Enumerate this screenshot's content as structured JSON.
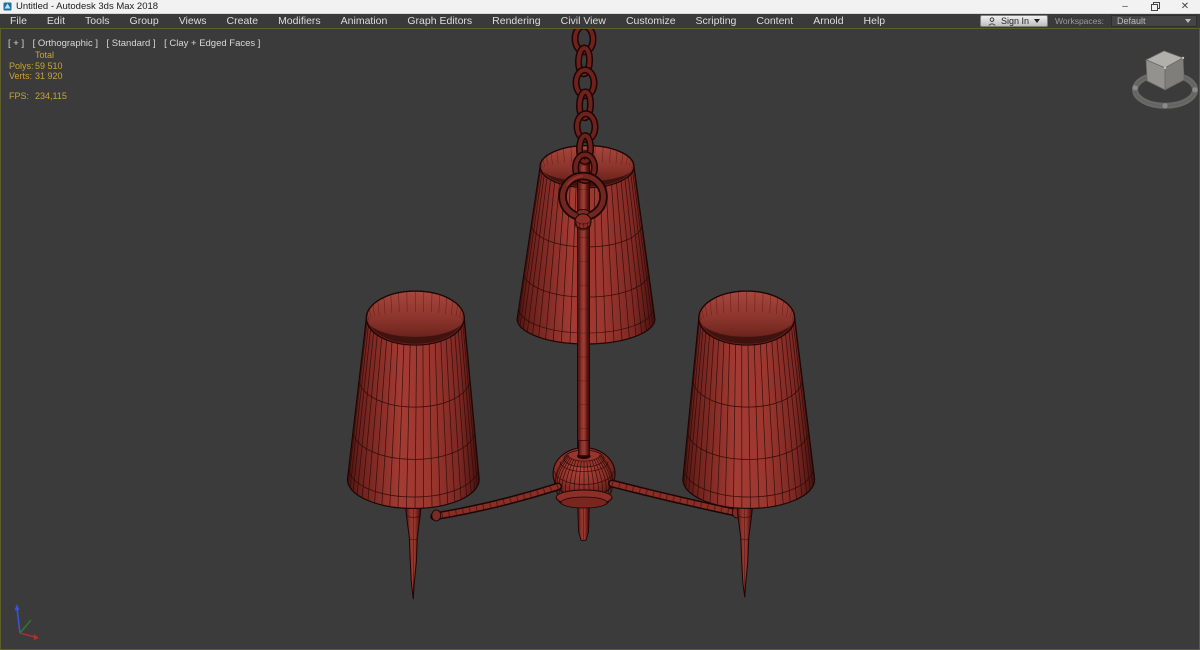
{
  "window": {
    "title": "Untitled - Autodesk 3ds Max 2018",
    "minimize": "–",
    "close": "✕"
  },
  "menu": {
    "items": [
      "File",
      "Edit",
      "Tools",
      "Group",
      "Views",
      "Create",
      "Modifiers",
      "Animation",
      "Graph Editors",
      "Rendering",
      "Civil View",
      "Customize",
      "Scripting",
      "Content",
      "Arnold",
      "Help"
    ]
  },
  "account": {
    "sign_in": "Sign In"
  },
  "workspaces": {
    "label": "Workspaces:",
    "selected": "Default"
  },
  "viewport": {
    "labels": {
      "pov": "[ + ]",
      "view": "[ Orthographic ]",
      "style": "[ Standard ]",
      "shading": "[ Clay + Edged Faces ]"
    },
    "statistics": {
      "header": "Total",
      "rows": [
        {
          "label": "Polys:",
          "value": "59 510"
        },
        {
          "label": "Verts:",
          "value": "31 920"
        }
      ],
      "fps_label": "FPS:",
      "fps_value": "234,115"
    }
  },
  "scene": {
    "object": "chandelier wireframe model",
    "colors": {
      "background": "#3b3b3b",
      "viewport_border": "#5e5e2d",
      "model_red": "#a23b33",
      "model_dark": "#4e1511",
      "wireframe": "#2e0a08",
      "stats_text": "#c9a23a"
    }
  }
}
